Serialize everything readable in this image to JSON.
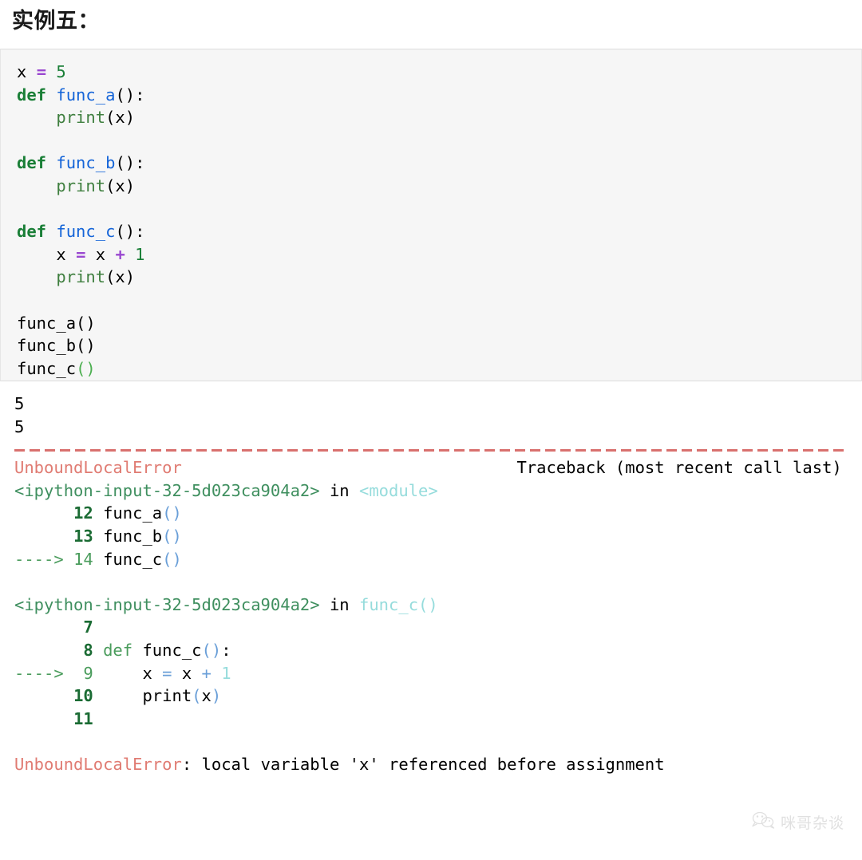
{
  "heading": {
    "title": "实例五："
  },
  "code_block": {
    "language": "python",
    "background": "#f6f6f6",
    "lines": [
      {
        "tokens": [
          {
            "t": "x ",
            "c": "plain"
          },
          {
            "t": "=",
            "c": "op"
          },
          {
            "t": " ",
            "c": "plain"
          },
          {
            "t": "5",
            "c": "num"
          }
        ]
      },
      {
        "tokens": [
          {
            "t": "def",
            "c": "kw"
          },
          {
            "t": " ",
            "c": "plain"
          },
          {
            "t": "func_a",
            "c": "fn"
          },
          {
            "t": "():",
            "c": "plain"
          }
        ]
      },
      {
        "tokens": [
          {
            "t": "    ",
            "c": "plain"
          },
          {
            "t": "print",
            "c": "builtin"
          },
          {
            "t": "(x)",
            "c": "plain"
          }
        ]
      },
      {
        "tokens": [
          {
            "t": " ",
            "c": "plain"
          }
        ]
      },
      {
        "tokens": [
          {
            "t": "def",
            "c": "kw"
          },
          {
            "t": " ",
            "c": "plain"
          },
          {
            "t": "func_b",
            "c": "fn"
          },
          {
            "t": "():",
            "c": "plain"
          }
        ]
      },
      {
        "tokens": [
          {
            "t": "    ",
            "c": "plain"
          },
          {
            "t": "print",
            "c": "builtin"
          },
          {
            "t": "(x)",
            "c": "plain"
          }
        ]
      },
      {
        "tokens": [
          {
            "t": " ",
            "c": "plain"
          }
        ]
      },
      {
        "tokens": [
          {
            "t": "def",
            "c": "kw"
          },
          {
            "t": " ",
            "c": "plain"
          },
          {
            "t": "func_c",
            "c": "fn"
          },
          {
            "t": "():",
            "c": "plain"
          }
        ]
      },
      {
        "tokens": [
          {
            "t": "    x ",
            "c": "plain"
          },
          {
            "t": "=",
            "c": "op"
          },
          {
            "t": " x ",
            "c": "plain"
          },
          {
            "t": "+",
            "c": "op"
          },
          {
            "t": " ",
            "c": "plain"
          },
          {
            "t": "1",
            "c": "num"
          }
        ]
      },
      {
        "tokens": [
          {
            "t": "    ",
            "c": "plain"
          },
          {
            "t": "print",
            "c": "builtin"
          },
          {
            "t": "(x)",
            "c": "plain"
          }
        ]
      },
      {
        "tokens": [
          {
            "t": " ",
            "c": "plain"
          }
        ]
      },
      {
        "tokens": [
          {
            "t": "func_a()",
            "c": "plain"
          }
        ]
      },
      {
        "tokens": [
          {
            "t": "func_b()",
            "c": "plain"
          }
        ]
      },
      {
        "tokens": [
          {
            "t": "func_c",
            "c": "plain"
          },
          {
            "t": "()",
            "c": "paren-g"
          }
        ]
      }
    ]
  },
  "stdout": {
    "lines": [
      "5",
      "5"
    ]
  },
  "separator": {
    "color": "#d9706e",
    "style": "dashed"
  },
  "traceback": {
    "header": {
      "error_name": "UnboundLocalError",
      "right_label": "Traceback (most recent call last)"
    },
    "frames": [
      {
        "file": "<ipython-input-32-5d023ca904a2>",
        "in_word": " in ",
        "scope": "<module>",
        "lines": [
          {
            "arrow": "",
            "no": "12",
            "current": false,
            "tokens": [
              {
                "t": " func_a",
                "c": "plain"
              },
              {
                "t": "()",
                "c": "paren"
              }
            ]
          },
          {
            "arrow": "",
            "no": "13",
            "current": false,
            "tokens": [
              {
                "t": " func_b",
                "c": "plain"
              },
              {
                "t": "()",
                "c": "paren"
              }
            ]
          },
          {
            "arrow": "---->",
            "no": "14",
            "current": true,
            "tokens": [
              {
                "t": " func_c",
                "c": "plain"
              },
              {
                "t": "()",
                "c": "paren"
              }
            ]
          }
        ]
      },
      {
        "file": "<ipython-input-32-5d023ca904a2>",
        "in_word": " in ",
        "scope": "func_c()",
        "lines": [
          {
            "arrow": "",
            "no": "7",
            "current": false,
            "tokens": []
          },
          {
            "arrow": "",
            "no": "8",
            "current": false,
            "tokens": [
              {
                "t": " ",
                "c": "plain"
              },
              {
                "t": "def",
                "c": "def"
              },
              {
                "t": " func_c",
                "c": "plain"
              },
              {
                "t": "()",
                "c": "paren"
              },
              {
                "t": ":",
                "c": "plain"
              }
            ]
          },
          {
            "arrow": "---->",
            "no": "9",
            "current": true,
            "tokens": [
              {
                "t": "     x ",
                "c": "plain"
              },
              {
                "t": "=",
                "c": "op"
              },
              {
                "t": " x ",
                "c": "plain"
              },
              {
                "t": "+",
                "c": "op"
              },
              {
                "t": " ",
                "c": "plain"
              },
              {
                "t": "1",
                "c": "num"
              }
            ]
          },
          {
            "arrow": "",
            "no": "10",
            "current": false,
            "tokens": [
              {
                "t": "     print",
                "c": "plain"
              },
              {
                "t": "(",
                "c": "paren"
              },
              {
                "t": "x",
                "c": "plain"
              },
              {
                "t": ")",
                "c": "paren"
              }
            ]
          },
          {
            "arrow": "",
            "no": "11",
            "current": false,
            "tokens": []
          }
        ]
      }
    ],
    "final": {
      "error_name": "UnboundLocalError",
      "message": ": local variable 'x' referenced before assignment"
    }
  },
  "watermark": {
    "icon": "wechat-icon",
    "text": "咪哥杂谈"
  }
}
